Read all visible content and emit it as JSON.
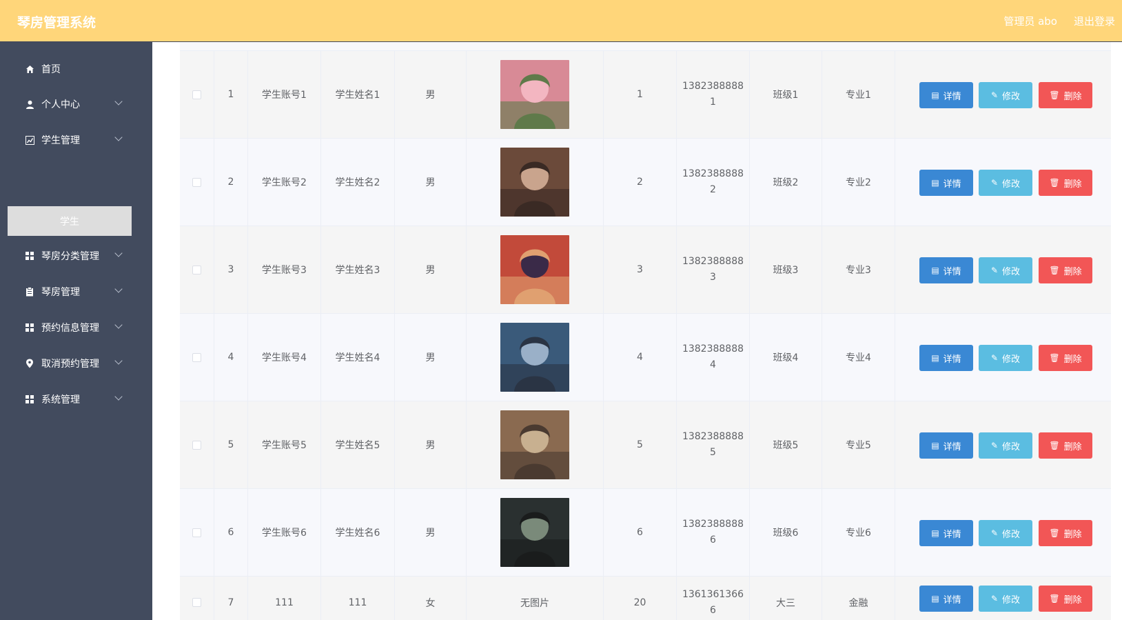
{
  "header": {
    "title": "琴房管理系统",
    "user": "管理员 abo",
    "logout": "退出登录"
  },
  "sidebar": {
    "items": [
      {
        "label": "首页",
        "icon": "home-icon",
        "expandable": false
      },
      {
        "label": "个人中心",
        "icon": "user-icon",
        "expandable": true
      },
      {
        "label": "学生管理",
        "icon": "chart-icon",
        "expandable": true
      },
      {
        "label": "琴房分类管理",
        "icon": "grid-icon",
        "expandable": true
      },
      {
        "label": "琴房管理",
        "icon": "clipboard-icon",
        "expandable": true
      },
      {
        "label": "预约信息管理",
        "icon": "grid-icon",
        "expandable": true
      },
      {
        "label": "取消预约管理",
        "icon": "pin-icon",
        "expandable": true
      },
      {
        "label": "系统管理",
        "icon": "grid-icon",
        "expandable": true
      }
    ],
    "active_sub": "学生"
  },
  "table": {
    "buttons": {
      "detail": "详情",
      "edit": "修改",
      "delete": "删除"
    },
    "rows": [
      {
        "index": "1",
        "account": "学生账号1",
        "name": "学生姓名1",
        "gender": "男",
        "photo": "photo-1",
        "age": "1",
        "phone1": "1382388888",
        "phone2": "1",
        "class": "班级1",
        "major": "专业1"
      },
      {
        "index": "2",
        "account": "学生账号2",
        "name": "学生姓名2",
        "gender": "男",
        "photo": "photo-2",
        "age": "2",
        "phone1": "1382388888",
        "phone2": "2",
        "class": "班级2",
        "major": "专业2"
      },
      {
        "index": "3",
        "account": "学生账号3",
        "name": "学生姓名3",
        "gender": "男",
        "photo": "photo-3",
        "age": "3",
        "phone1": "1382388888",
        "phone2": "3",
        "class": "班级3",
        "major": "专业3"
      },
      {
        "index": "4",
        "account": "学生账号4",
        "name": "学生姓名4",
        "gender": "男",
        "photo": "photo-4",
        "age": "4",
        "phone1": "1382388888",
        "phone2": "4",
        "class": "班级4",
        "major": "专业4"
      },
      {
        "index": "5",
        "account": "学生账号5",
        "name": "学生姓名5",
        "gender": "男",
        "photo": "photo-5",
        "age": "5",
        "phone1": "1382388888",
        "phone2": "5",
        "class": "班级5",
        "major": "专业5"
      },
      {
        "index": "6",
        "account": "学生账号6",
        "name": "学生姓名6",
        "gender": "男",
        "photo": "photo-6",
        "age": "6",
        "phone1": "1382388888",
        "phone2": "6",
        "class": "班级6",
        "major": "专业6"
      },
      {
        "index": "7",
        "account": "111",
        "name": "111",
        "gender": "女",
        "photo": "",
        "photo_text": "无图片",
        "age": "20",
        "phone1": "1361361366",
        "phone2": "6",
        "class": "大三",
        "major": "金融"
      }
    ]
  },
  "colors": {
    "header_bg": "#ffd67a",
    "sidebar_bg": "#424b5e",
    "detail": "#3a88d4",
    "edit": "#5bbde1",
    "delete": "#f25656"
  }
}
